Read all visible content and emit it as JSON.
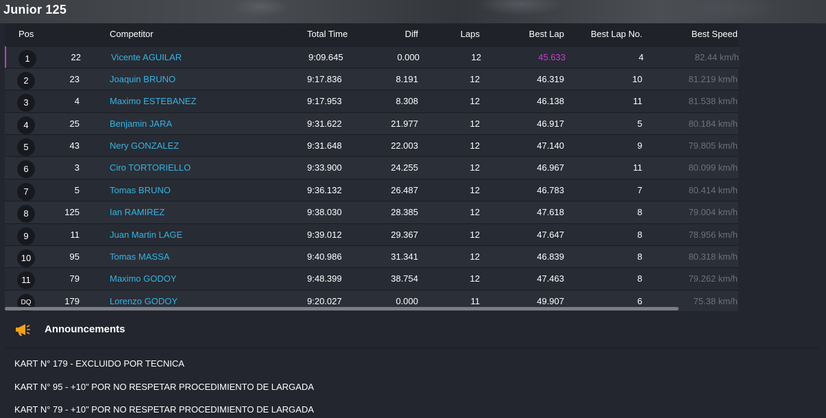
{
  "page": {
    "title": "Junior 125"
  },
  "table": {
    "headers": {
      "pos": "Pos",
      "competitor": "Competitor",
      "total_time": "Total Time",
      "diff": "Diff",
      "laps": "Laps",
      "best_lap": "Best Lap",
      "best_lap_no": "Best Lap No.",
      "best_speed": "Best Speed"
    },
    "rows": [
      {
        "pos": "1",
        "num": "22",
        "name": "Vicente AGUILAR",
        "total": "9:09.645",
        "diff": "0.000",
        "laps": "12",
        "best": "45.633",
        "bestno": "4",
        "speed": "82.44 km/h"
      },
      {
        "pos": "2",
        "num": "23",
        "name": "Joaquin BRUNO",
        "total": "9:17.836",
        "diff": "8.191",
        "laps": "12",
        "best": "46.319",
        "bestno": "10",
        "speed": "81.219 km/h"
      },
      {
        "pos": "3",
        "num": "4",
        "name": "Maximo ESTEBANEZ",
        "total": "9:17.953",
        "diff": "8.308",
        "laps": "12",
        "best": "46.138",
        "bestno": "11",
        "speed": "81.538 km/h"
      },
      {
        "pos": "4",
        "num": "25",
        "name": "Benjamin JARA",
        "total": "9:31.622",
        "diff": "21.977",
        "laps": "12",
        "best": "46.917",
        "bestno": "5",
        "speed": "80.184 km/h"
      },
      {
        "pos": "5",
        "num": "43",
        "name": "Nery GONZALEZ",
        "total": "9:31.648",
        "diff": "22.003",
        "laps": "12",
        "best": "47.140",
        "bestno": "9",
        "speed": "79.805 km/h"
      },
      {
        "pos": "6",
        "num": "3",
        "name": "Ciro TORTORIELLO",
        "total": "9:33.900",
        "diff": "24.255",
        "laps": "12",
        "best": "46.967",
        "bestno": "11",
        "speed": "80.099 km/h"
      },
      {
        "pos": "7",
        "num": "5",
        "name": "Tomas BRUNO",
        "total": "9:36.132",
        "diff": "26.487",
        "laps": "12",
        "best": "46.783",
        "bestno": "7",
        "speed": "80.414 km/h"
      },
      {
        "pos": "8",
        "num": "125",
        "name": "Ian RAMIREZ",
        "total": "9:38.030",
        "diff": "28.385",
        "laps": "12",
        "best": "47.618",
        "bestno": "8",
        "speed": "79.004 km/h"
      },
      {
        "pos": "9",
        "num": "11",
        "name": "Juan Martin LAGE",
        "total": "9:39.012",
        "diff": "29.367",
        "laps": "12",
        "best": "47.647",
        "bestno": "8",
        "speed": "78.956 km/h"
      },
      {
        "pos": "10",
        "num": "95",
        "name": "Tomas MASSA",
        "total": "9:40.986",
        "diff": "31.341",
        "laps": "12",
        "best": "46.839",
        "bestno": "8",
        "speed": "80.318 km/h"
      },
      {
        "pos": "11",
        "num": "79",
        "name": "Maximo GODOY",
        "total": "9:48.399",
        "diff": "38.754",
        "laps": "12",
        "best": "47.463",
        "bestno": "8",
        "speed": "79.262 km/h"
      },
      {
        "pos": "DQ",
        "num": "179",
        "name": "Lorenzo GODOY",
        "total": "9:20.027",
        "diff": "0.000",
        "laps": "11",
        "best": "49.907",
        "bestno": "6",
        "speed": "75.38 km/h"
      }
    ]
  },
  "announcements": {
    "title": "Announcements",
    "icon": "megaphone-icon",
    "accent_color": "#f5a01a",
    "items": [
      "KART N° 179 - EXCLUIDO POR TECNICA",
      "KART N° 95 - +10\" POR NO RESPETAR PROCEDIMIENTO DE LARGADA",
      "KART N° 79 - +10\" POR NO RESPETAR PROCEDIMIENTO DE LARGADA"
    ]
  },
  "colors": {
    "competitor_link": "#33b5e5",
    "best_lap_highlight": "#c73ed6",
    "speed_text": "#6c717a"
  }
}
